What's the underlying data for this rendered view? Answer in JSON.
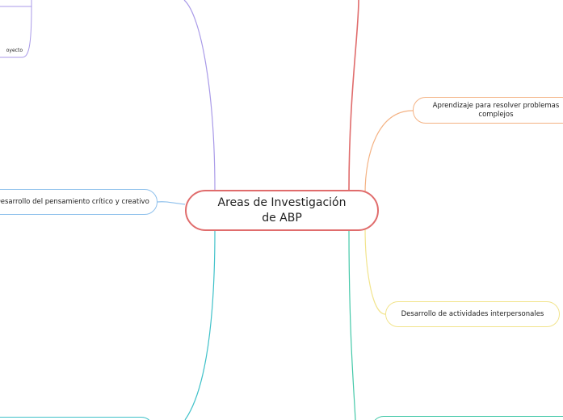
{
  "central": {
    "title": "Areas de Investigación de ABP"
  },
  "nodes": {
    "aprendizaje": "Aprendizaje para resolver problemas complejos",
    "pensamiento": "Desarrollo del pensamiento crítico y creativo",
    "actividades": "Desarrollo de actividades interpersonales",
    "proyecto_fragment": "oyecto"
  },
  "colors": {
    "central_border": "#e06c6c",
    "red_branch": "#e06c6c",
    "purple_branch": "#a99ae8",
    "orange_branch": "#f4b283",
    "yellow_branch": "#f2e48d",
    "blue_branch": "#8ec0ec",
    "teal_branch": "#3fc1c9",
    "green_branch": "#43c8a8"
  }
}
